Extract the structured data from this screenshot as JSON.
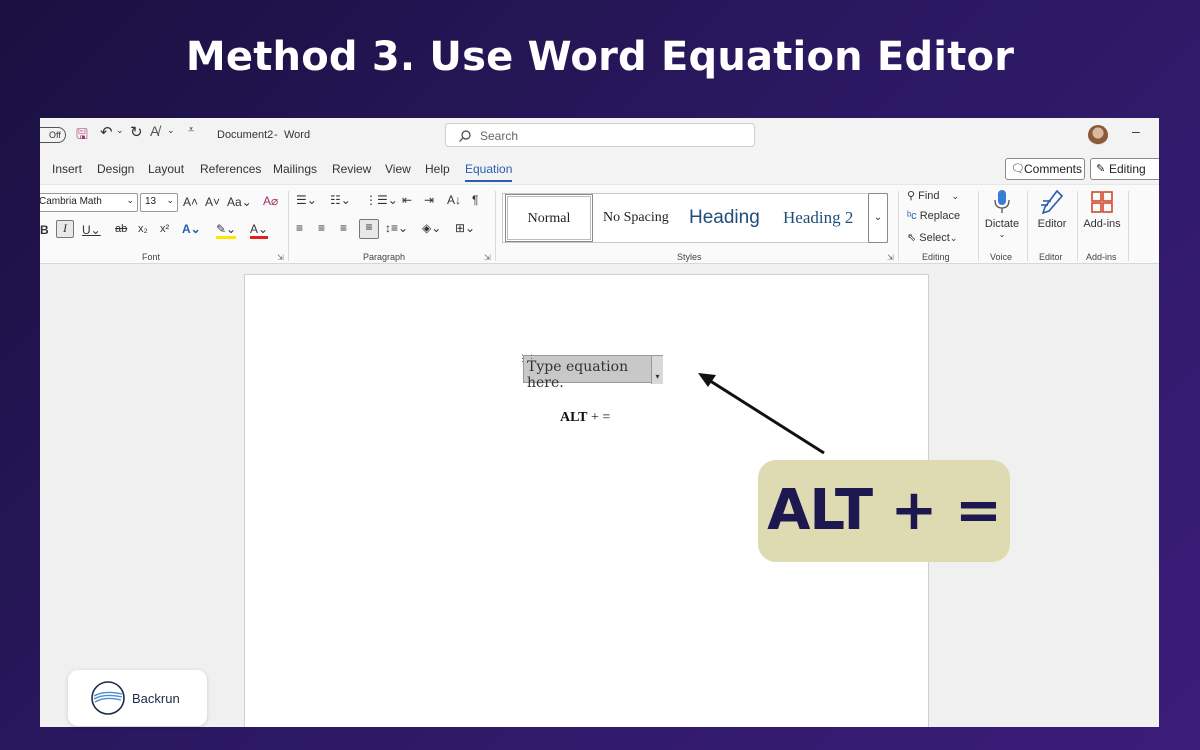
{
  "headline": "Method 3. Use Word Equation Editor",
  "titlebar": {
    "autosave": "Off",
    "doc_title": "Document2",
    "app_sep": "-",
    "app_name": "Word",
    "search_placeholder": "Search",
    "minimize": "–"
  },
  "menu": {
    "tabs": [
      "Insert",
      "Design",
      "Layout",
      "References",
      "Mailings",
      "Review",
      "View",
      "Help",
      "Equation"
    ],
    "active_tab": "Equation",
    "comments_label": "Comments",
    "editing_label": "Editing"
  },
  "ribbon": {
    "font_name": "Cambria Math",
    "font_size": "13",
    "groups": {
      "font": "Font",
      "paragraph": "Paragraph",
      "styles": "Styles",
      "editing": "Editing",
      "voice": "Voice",
      "editor": "Editor",
      "addins": "Add-ins"
    },
    "styles": [
      "Normal",
      "No Spacing",
      "Heading",
      "Heading 2"
    ],
    "find": "Find",
    "replace": "Replace",
    "select": "Select",
    "dictate": "Dictate",
    "editor_btn": "Editor",
    "addins_btn": "Add-ins"
  },
  "document": {
    "equation_placeholder": "Type equation here.",
    "shortcut_text_bold": "ALT",
    "shortcut_text_rest": " + ="
  },
  "callout": "ALT + =",
  "logo": "Backrun",
  "colors": {
    "accent": "#2a5db0",
    "callout_bg": "#dedbb3",
    "callout_text": "#1d1850",
    "bg_start": "#1a1040",
    "bg_end": "#3b1d7a"
  }
}
